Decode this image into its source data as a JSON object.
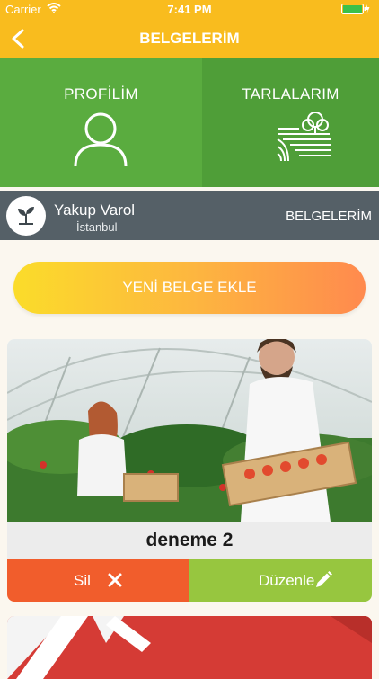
{
  "status_bar": {
    "carrier": "Carrier",
    "time": "7:41 PM"
  },
  "nav": {
    "title": "BELGELERİM"
  },
  "tiles": {
    "profile_label": "PROFİLİM",
    "fields_label": "TARLALARIM"
  },
  "user": {
    "name": "Yakup Varol",
    "city": "İstanbul",
    "section": "BELGELERİM"
  },
  "add_button": {
    "label": "YENİ BELGE EKLE"
  },
  "documents": [
    {
      "title": "deneme 2",
      "delete_label": "Sil",
      "edit_label": "Düzenle"
    }
  ],
  "colors": {
    "header": "#f9bc1e",
    "tile_left": "#5aac3f",
    "tile_right": "#4f9e38",
    "user_bar": "#556067",
    "delete": "#f15d2c",
    "edit": "#97c63f"
  },
  "icons": {
    "back": "chevron-left-icon",
    "profile": "user-icon",
    "fields": "field-tree-icon",
    "avatar": "sprout-icon",
    "delete": "close-icon",
    "edit": "pencil-icon"
  }
}
